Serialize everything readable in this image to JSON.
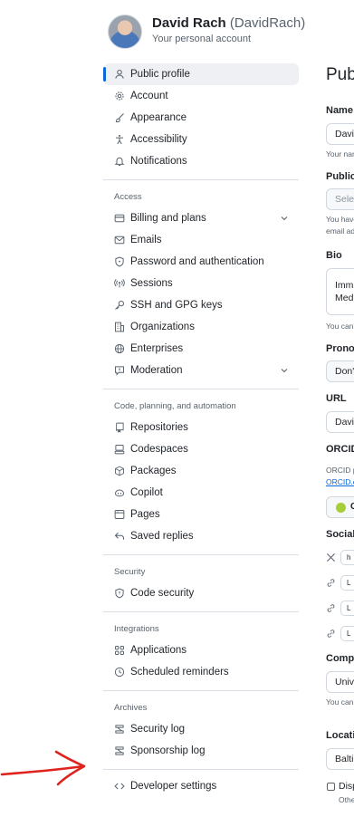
{
  "header": {
    "name": "David Rach",
    "login": "(DavidRach)",
    "subtitle": "Your personal account"
  },
  "sidebar": {
    "main": [
      {
        "label": "Public profile",
        "icon": "person-icon",
        "active": true
      },
      {
        "label": "Account",
        "icon": "gear-icon"
      },
      {
        "label": "Appearance",
        "icon": "paintbrush-icon"
      },
      {
        "label": "Accessibility",
        "icon": "accessibility-icon"
      },
      {
        "label": "Notifications",
        "icon": "bell-icon"
      }
    ],
    "access_title": "Access",
    "access": [
      {
        "label": "Billing and plans",
        "icon": "credit-card-icon",
        "expand": true
      },
      {
        "label": "Emails",
        "icon": "mail-icon"
      },
      {
        "label": "Password and authentication",
        "icon": "shield-lock-icon"
      },
      {
        "label": "Sessions",
        "icon": "broadcast-icon"
      },
      {
        "label": "SSH and GPG keys",
        "icon": "key-icon"
      },
      {
        "label": "Organizations",
        "icon": "organization-icon"
      },
      {
        "label": "Enterprises",
        "icon": "globe-icon"
      },
      {
        "label": "Moderation",
        "icon": "report-icon",
        "expand": true
      }
    ],
    "code_title": "Code, planning, and automation",
    "code": [
      {
        "label": "Repositories",
        "icon": "repo-icon"
      },
      {
        "label": "Codespaces",
        "icon": "codespaces-icon"
      },
      {
        "label": "Packages",
        "icon": "package-icon"
      },
      {
        "label": "Copilot",
        "icon": "copilot-icon"
      },
      {
        "label": "Pages",
        "icon": "browser-icon"
      },
      {
        "label": "Saved replies",
        "icon": "reply-icon"
      }
    ],
    "security_title": "Security",
    "security": [
      {
        "label": "Code security",
        "icon": "shield-icon"
      }
    ],
    "integrations_title": "Integrations",
    "integrations": [
      {
        "label": "Applications",
        "icon": "apps-icon"
      },
      {
        "label": "Scheduled reminders",
        "icon": "clock-icon"
      }
    ],
    "archives_title": "Archives",
    "archives": [
      {
        "label": "Security log",
        "icon": "log-icon"
      },
      {
        "label": "Sponsorship log",
        "icon": "log-icon"
      }
    ],
    "developer": {
      "label": "Developer settings",
      "icon": "code-icon"
    }
  },
  "right": {
    "title": "Publ",
    "name_label": "Name",
    "name_value": "Davi",
    "name_help": "Your nam",
    "public_email_label": "Public",
    "public_email_select": "Selec",
    "public_email_help1": "You have",
    "public_email_help2": "email ad",
    "bio_label": "Bio",
    "bio_line1": "Imm",
    "bio_line2": "Med",
    "bio_help": "You can",
    "pronouns_label": "Pronou",
    "pronouns_value": "Don'",
    "url_label": "URL",
    "url_value": "Davi",
    "orcid_label": "ORCID",
    "orcid_help": "ORCID p",
    "orcid_link": "ORCID.o",
    "orcid_btn": "C",
    "social_label": "Social",
    "social_values": [
      "h",
      "L",
      "L",
      "L"
    ],
    "company_label": "Compa",
    "company_value": "Univ",
    "company_help": "You can",
    "location_label": "Locatio",
    "location_value": "Balti",
    "display_label": "Disp",
    "display_help": "Othe"
  }
}
